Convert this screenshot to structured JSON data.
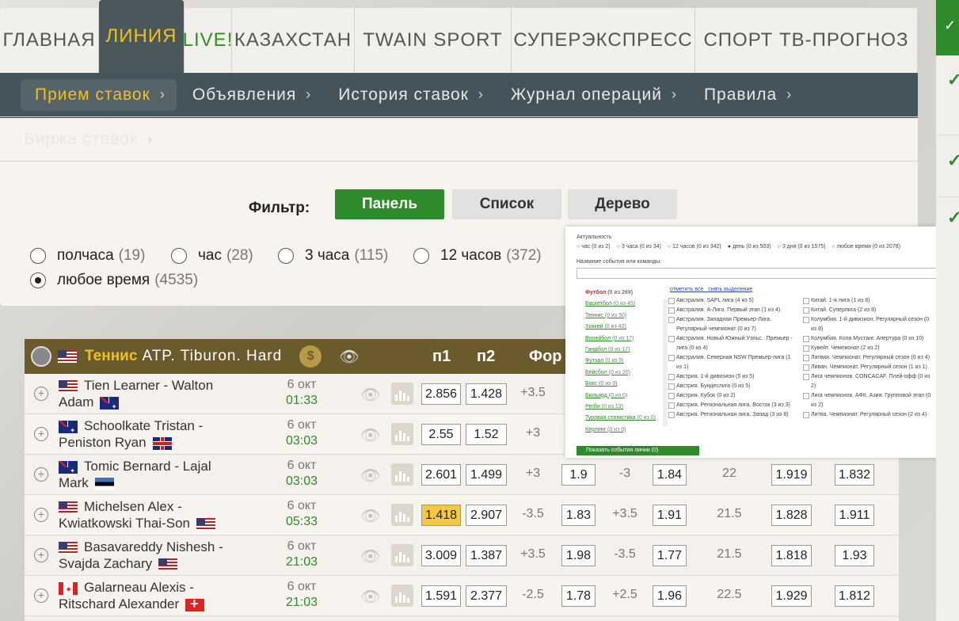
{
  "topnav": [
    {
      "label": "ГЛАВНАЯ",
      "cls": ""
    },
    {
      "label": "ЛИНИЯ",
      "cls": "active"
    },
    {
      "label": "LIVE!",
      "cls": "live"
    },
    {
      "label": "КАЗАХСТАН",
      "cls": ""
    },
    {
      "label": "TWAIN SPORT",
      "cls": ""
    },
    {
      "label": "СУПЕРЭКСПРЕСС",
      "cls": ""
    },
    {
      "label": "СПОРТ ТВ-ПРОГНОЗ",
      "cls": ""
    }
  ],
  "subnav": {
    "row1": [
      "Прием ставок",
      "Объявления",
      "История ставок",
      "Журнал операций",
      "Правила"
    ],
    "row2": [
      "Биржа ставок"
    ]
  },
  "filter": {
    "label": "Фильтр:",
    "buttons": [
      "Панель",
      "Список",
      "Дерево"
    ],
    "radios": [
      {
        "label": "полчаса",
        "count": "(19)",
        "checked": false
      },
      {
        "label": "час",
        "count": "(28)",
        "checked": false
      },
      {
        "label": "3 часа",
        "count": "(115)",
        "checked": false
      },
      {
        "label": "12 часов",
        "count": "(372)",
        "checked": false
      },
      {
        "label": "любое время",
        "count": "(4535)",
        "checked": true
      }
    ]
  },
  "table": {
    "sport": "Теннис",
    "title": "ATP. Tiburon. Hard",
    "coin": "$",
    "cols": [
      "п1",
      "п2",
      "Фор"
    ],
    "rows": [
      {
        "name1": "Tien Learner - Walton",
        "name2": "Adam",
        "f1": "us",
        "f2": "au",
        "date": "6 окт",
        "time": "01:33",
        "p1": "2.856",
        "p2": "1.428",
        "fora": "+3.5",
        "f1v": "",
        "fora2": "",
        "f2v": "",
        "tot": "",
        "o": "",
        "u": "",
        "hl": false
      },
      {
        "name1": "Schoolkate Tristan -",
        "name2": "Peniston Ryan",
        "f1": "au",
        "f2": "gb",
        "date": "6 окт",
        "time": "03:03",
        "p1": "2.55",
        "p2": "1.52",
        "fora": "+3",
        "f1v": "",
        "fora2": "",
        "f2v": "",
        "tot": "",
        "o": "",
        "u": "",
        "hl": false
      },
      {
        "name1": "Tomic Bernard - Lajal",
        "name2": "Mark",
        "f1": "au",
        "f2": "ee",
        "date": "6 окт",
        "time": "03:03",
        "p1": "2.601",
        "p2": "1.499",
        "fora": "+3",
        "f1v": "1.9",
        "fora2": "-3",
        "f2v": "1.84",
        "tot": "22",
        "o": "1.919",
        "u": "1.832",
        "hl": false
      },
      {
        "name1": "Michelsen Alex -",
        "name2": "Kwiatkowski Thai-Son",
        "f1": "us",
        "f2": "us",
        "date": "6 окт",
        "time": "05:33",
        "p1": "1.418",
        "p2": "2.907",
        "fora": "-3.5",
        "f1v": "1.83",
        "fora2": "+3.5",
        "f2v": "1.91",
        "tot": "21.5",
        "o": "1.828",
        "u": "1.911",
        "hl": true
      },
      {
        "name1": "Basavareddy Nishesh -",
        "name2": "Svajda Zachary",
        "f1": "us",
        "f2": "us",
        "date": "6 окт",
        "time": "21:03",
        "p1": "3.009",
        "p2": "1.387",
        "fora": "+3.5",
        "f1v": "1.98",
        "fora2": "-3.5",
        "f2v": "1.77",
        "tot": "21.5",
        "o": "1.818",
        "u": "1.93",
        "hl": false
      },
      {
        "name1": "Galarneau Alexis -",
        "name2": "Ritschard Alexander",
        "f1": "ca",
        "f2": "ch",
        "date": "6 окт",
        "time": "21:03",
        "p1": "1.591",
        "p2": "2.377",
        "fora": "-2.5",
        "f1v": "1.78",
        "fora2": "+2.5",
        "f2v": "1.96",
        "tot": "22.5",
        "o": "1.929",
        "u": "1.812",
        "hl": false
      }
    ]
  },
  "popup": {
    "title": "Актуальность",
    "options": [
      {
        "label": "час (0 из 2)",
        "on": false
      },
      {
        "label": "3 часа (0 из 34)",
        "on": false
      },
      {
        "label": "12 часов (0 из 342)",
        "on": false
      },
      {
        "label": "день (0 из 503)",
        "on": true
      },
      {
        "label": "3 дня (0 из 1575)",
        "on": false
      },
      {
        "label": "любое время (0 из 2078)",
        "on": false
      }
    ],
    "search_label": "Название события или команды:",
    "sports": [
      {
        "name": "Футбол",
        "count": "(0 из 269)"
      },
      {
        "name": "Баскетбол",
        "count": "(0 из 45)"
      },
      {
        "name": "Теннис",
        "count": "(0 из 50)"
      },
      {
        "name": "Хоккей",
        "count": "(0 из 42)"
      },
      {
        "name": "Волейбол",
        "count": "(0 из 17)"
      },
      {
        "name": "Гандбол",
        "count": "(0 из 17)"
      },
      {
        "name": "Футзал",
        "count": "(0 из 9)"
      },
      {
        "name": "Бейсбол",
        "count": "(0 из 20)"
      },
      {
        "name": "Бокс",
        "count": "(0 из 0)"
      },
      {
        "name": "Бильярд",
        "count": "(0 из 0)"
      },
      {
        "name": "Регби",
        "count": "(0 из 19)"
      },
      {
        "name": "Туровая статистика",
        "count": "(0 из 0)"
      },
      {
        "name": "Керлинг",
        "count": "(0 из 0)"
      }
    ],
    "link_mark": "отметить все",
    "link_clear": "снять выделение",
    "leagues_left": [
      "Австралия. SAPL лига (4 из 5)",
      "Австралия. А-Лига. Первый этап (1 из 4)",
      "Австралия. Западная Премьер-Лига. Регулярный чемпионат (0 из 7)",
      "Австралия. Новый Южный Уэльс.. Премьер - лига (0 из 4)",
      "Австралия. Северная NSW Премьер-лига (1 из 1)",
      "Австрия. 1-й дивизион (5 из 5)",
      "Австрия. Бундеслига (0 из 5)",
      "Австрия. Кубок (0 из 2)",
      "Австрия. Региональная лига. Восток (3 из 3)",
      "Австрия. Региональная лига. Запад (3 из 8)"
    ],
    "leagues_right": [
      "Китай. 1-я лига (1 из 8)",
      "Китай. Суперлига (2 из 8)",
      "Колумбия. 1-й дивизион. Регулярный сезон (0 из 8)",
      "Колумбия. Копа Мустанг. Апертура (0 из 10)",
      "Кувейт. Чемпионат (2 из 2)",
      "Латвия. Чемпионат. Регулярный сезон (0 из 4)",
      "Ливан. Чемпионат. Регулярный сезон (1 из 1)",
      "Лига чемпионов. CONCACAF. Плей-офф (0 из 2)",
      "Лига чемпионов. АФК. Азия. Групповой этап (0 из 2)",
      "Литва. Чемпионат. Регулярный сезон (2 из 4)"
    ],
    "show_button": "Показать события линии (0)"
  }
}
